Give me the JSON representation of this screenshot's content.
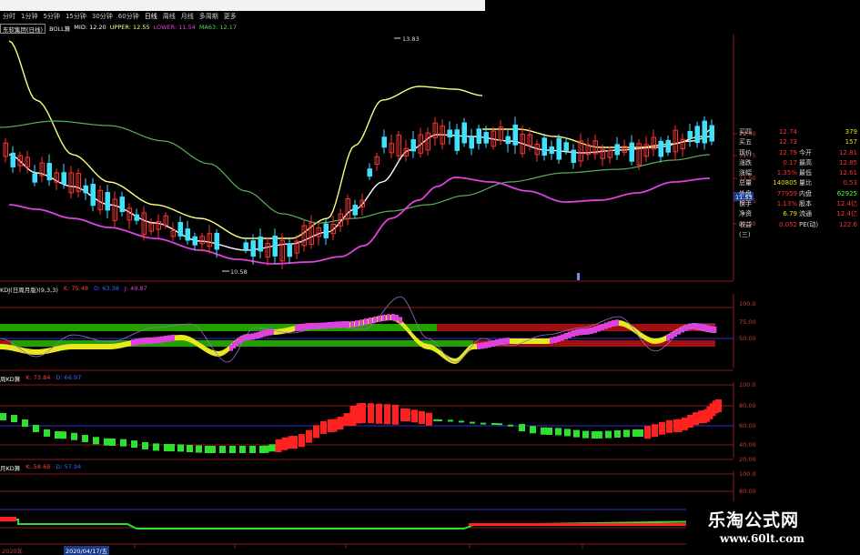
{
  "tabs": [
    "分时",
    "1分钟",
    "5分钟",
    "15分钟",
    "30分钟",
    "60分钟",
    "日线",
    "周线",
    "月线",
    "多周期",
    "更多"
  ],
  "stock": {
    "name": "东软集团(日线)",
    "boll_label": "BOLL算",
    "mid": "MID: 12.20",
    "upper": "UPPER: 12.55",
    "lower": "LOWER: 11.54",
    "ma": "MA63: 12.17"
  },
  "price_panel": {
    "high_label": "13.83",
    "low_label": "10.58",
    "current_tag": "11.53",
    "y_ticks": [
      "12.00",
      "11.75",
      "11.50",
      "11.25",
      "11.00"
    ]
  },
  "kdj_panel": {
    "label": "KDJ(日周月版)(9,3,3)",
    "k": "K: 75.48",
    "d": "D: 63.38",
    "j": "J: 49.87",
    "y_ticks": [
      "100.0",
      "75.00",
      "50.00"
    ]
  },
  "weekly_panel": {
    "label": "周KD算",
    "k": "K: 73.84",
    "d": "D: 66.97",
    "y_ticks": [
      "100.0",
      "80.00",
      "60.00",
      "40.00",
      "20.00"
    ]
  },
  "monthly_panel": {
    "label": "月KD算",
    "k": "K: 58.69",
    "d": "D: 57.94",
    "y_ticks": [
      "100.0",
      "80.00"
    ]
  },
  "quote": {
    "rows": [
      {
        "k": "买四",
        "v1": "12.74",
        "k2": "",
        "v2": "379"
      },
      {
        "k": "买五",
        "v1": "12.73",
        "k2": "",
        "v2": "157"
      },
      {
        "k": "现价",
        "v1": "12.79",
        "k2": "今开",
        "v2": "12.81"
      },
      {
        "k": "涨跌",
        "v1": "0.17",
        "k2": "最高",
        "v2": "12.85"
      },
      {
        "k": "涨幅",
        "v1": "1.35%",
        "k2": "最低",
        "v2": "12.61"
      },
      {
        "k": "总量",
        "v1": "140805",
        "k2": "量比",
        "v2": "0.53"
      },
      {
        "k": "外盘",
        "v1": "77959",
        "k2": "内盘",
        "v2": "62925"
      },
      {
        "k": "换手",
        "v1": "1.13%",
        "k2": "股本",
        "v2": "12.4亿"
      },
      {
        "k": "净资",
        "v1": "6.79",
        "k2": "流通",
        "v2": "12.4亿"
      },
      {
        "k": "收益(三)",
        "v1": "0.052",
        "k2": "PE(动)",
        "v2": "122.6"
      }
    ]
  },
  "bottom_dates": [
    "2020年",
    "2020/04/17/五"
  ],
  "watermark": {
    "title": "乐淘公式网",
    "url": "www.60lt.com"
  },
  "colors": {
    "bg": "#000000",
    "grid": "#8b1a1a",
    "up": "#ff3030",
    "down": "#40e0ff",
    "upper": "#ffff80",
    "mid": "#ffffff",
    "ma63": "#58b058",
    "lower": "#e040e0",
    "green_band": "#22a000",
    "red_band": "#a01010"
  }
}
